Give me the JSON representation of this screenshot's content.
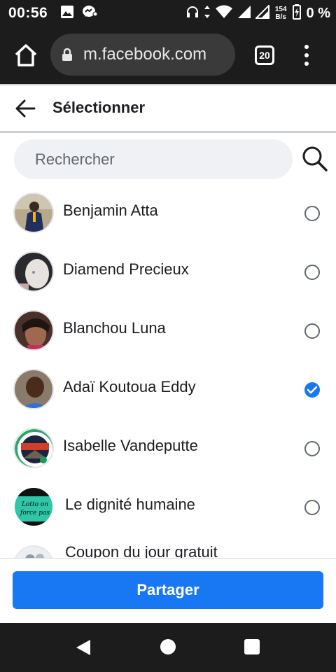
{
  "status_bar": {
    "time": "00:56",
    "speed_value": "154",
    "speed_unit": "B/s",
    "battery": "0 %",
    "icons": [
      "image-icon",
      "messenger-notification-icon",
      "headphones-icon",
      "data-arrows-icon",
      "wifi-icon",
      "signal-icon",
      "signal-icon",
      "battery-charging-icon"
    ]
  },
  "browser": {
    "url": "m.facebook.com",
    "tab_count": "20",
    "icons": [
      "home-icon",
      "lock-icon",
      "tabs-icon",
      "more-menu-icon"
    ]
  },
  "header": {
    "title": "Sélectionner",
    "back_icon": "arrow-left-icon"
  },
  "search": {
    "placeholder": "Rechercher",
    "value": "",
    "icon": "search-icon"
  },
  "contacts": [
    {
      "name": "Benjamin Atta",
      "selected": false
    },
    {
      "name": "Diamend Precieux",
      "selected": false
    },
    {
      "name": "Blanchou Luna",
      "selected": false
    },
    {
      "name": "Adaï Koutoua Eddy",
      "selected": true
    },
    {
      "name": "Isabelle Vandeputte",
      "selected": false
    },
    {
      "name": "Le dignité humaine",
      "selected": false,
      "avatar_text": [
        "Lotto on",
        "force pas"
      ]
    },
    {
      "name": "Coupon du jour gratuit",
      "selected": false
    }
  ],
  "footer": {
    "share_label": "Partager"
  },
  "nav": {
    "icons": [
      "nav-back-icon",
      "nav-home-icon",
      "nav-recents-icon"
    ]
  },
  "colors": {
    "accent": "#1877f2",
    "system_bar": "#1c1c1c",
    "search_bg": "#eff1f4"
  }
}
